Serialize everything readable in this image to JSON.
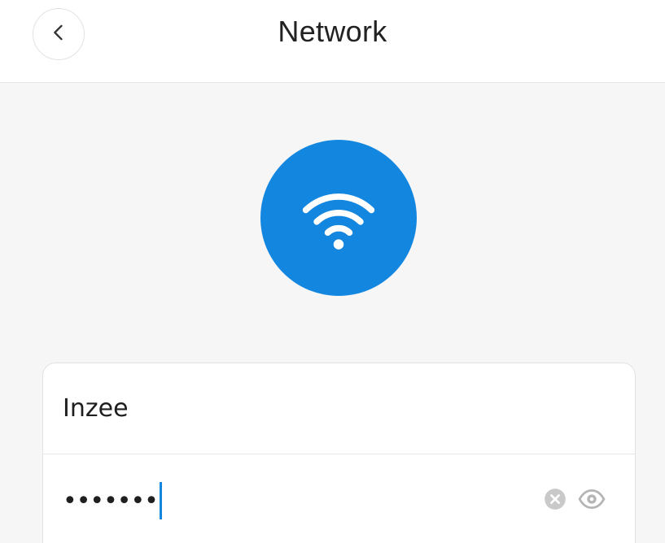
{
  "header": {
    "title": "Network",
    "back_icon": "chevron-left-icon"
  },
  "network": {
    "icon": "wifi-icon",
    "accent_color": "#1386e0"
  },
  "form": {
    "ssid_value": "Inzee",
    "password_masked": "•••••••",
    "clear_icon": "clear-icon",
    "visibility_icon": "eye-icon"
  }
}
